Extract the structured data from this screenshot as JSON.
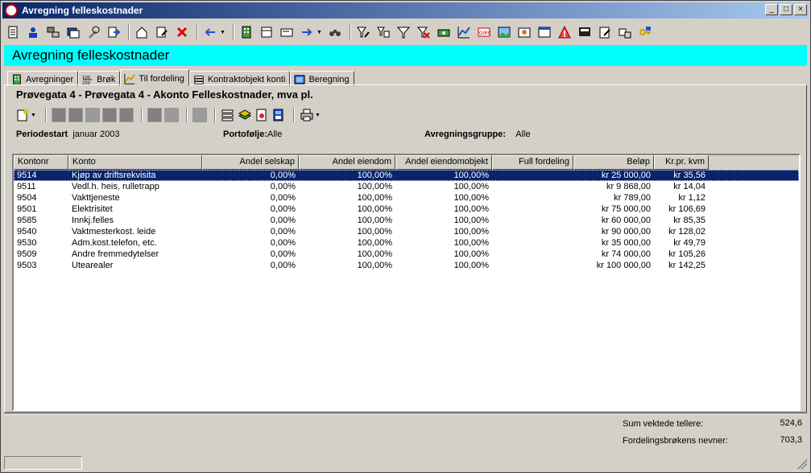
{
  "window": {
    "title": "Avregning felleskostnader"
  },
  "window_buttons": [
    "_",
    "□",
    "×"
  ],
  "module": {
    "title": "Avregning felleskostnader"
  },
  "tabs": [
    {
      "label": "Avregninger",
      "icon": "building-icon"
    },
    {
      "label": "Brøk",
      "icon": "fraction-icon"
    },
    {
      "label": "Til fordeling",
      "icon": "chart-icon"
    },
    {
      "label": "Kontraktobjekt konti",
      "icon": "stack-icon"
    },
    {
      "label": "Beregning",
      "icon": "calculator-icon"
    }
  ],
  "active_tab": 2,
  "heading": "Prøvegata 4 - Prøvegata 4 - Akonto Felleskostnader, mva pl.",
  "info": {
    "periodestart_label": "Periodestart",
    "periodestart_value": "januar 2003",
    "portfolio_label": "Portofølje:",
    "portfolio_value": "Alle",
    "group_label": "Avregningsgruppe:",
    "group_value": "Alle"
  },
  "table": {
    "columns": [
      "Kontonr",
      "Konto",
      "Andel selskap",
      "Andel eiendom",
      "Andel eiendomobjekt",
      "Full fordeling",
      "Beløp",
      "Kr.pr. kvm"
    ],
    "rows": [
      [
        "9514",
        "Kjøp av driftsrekvisita",
        "0,00%",
        "100,00%",
        "100,00%",
        "",
        "kr 25 000,00",
        "kr 35,56"
      ],
      [
        "9511",
        "Vedl.h. heis, rulletrapp",
        "0,00%",
        "100,00%",
        "100,00%",
        "",
        "kr 9 868,00",
        "kr 14,04"
      ],
      [
        "9504",
        "Vakttjeneste",
        "0,00%",
        "100,00%",
        "100,00%",
        "",
        "kr 789,00",
        "kr 1,12"
      ],
      [
        "9501",
        "Elektrisitet",
        "0,00%",
        "100,00%",
        "100,00%",
        "",
        "kr 75 000,00",
        "kr 106,69"
      ],
      [
        "9585",
        "Innkj.felles",
        "0,00%",
        "100,00%",
        "100,00%",
        "",
        "kr 60 000,00",
        "kr 85,35"
      ],
      [
        "9540",
        "Vaktmesterkost. leide",
        "0,00%",
        "100,00%",
        "100,00%",
        "",
        "kr 90 000,00",
        "kr 128,02"
      ],
      [
        "9530",
        "Adm.kost.telefon, etc.",
        "0,00%",
        "100,00%",
        "100,00%",
        "",
        "kr 35 000,00",
        "kr 49,79"
      ],
      [
        "9509",
        "Andre fremmedytelser",
        "0,00%",
        "100,00%",
        "100,00%",
        "",
        "kr 74 000,00",
        "kr 105,26"
      ],
      [
        "9503",
        "Utearealer",
        "0,00%",
        "100,00%",
        "100,00%",
        "",
        "kr 100 000,00",
        "kr 142,25"
      ]
    ],
    "selected_row": 0
  },
  "summary": {
    "sum_label": "Sum vektede tellere:",
    "sum_value": "524,6",
    "denominator_label": "Fordelingsbrøkens nevner:",
    "denominator_value": "703,3"
  },
  "colors": {
    "header_bg": "#00ffff",
    "selection": "#0a246a",
    "titlebar": "#0a246a"
  }
}
